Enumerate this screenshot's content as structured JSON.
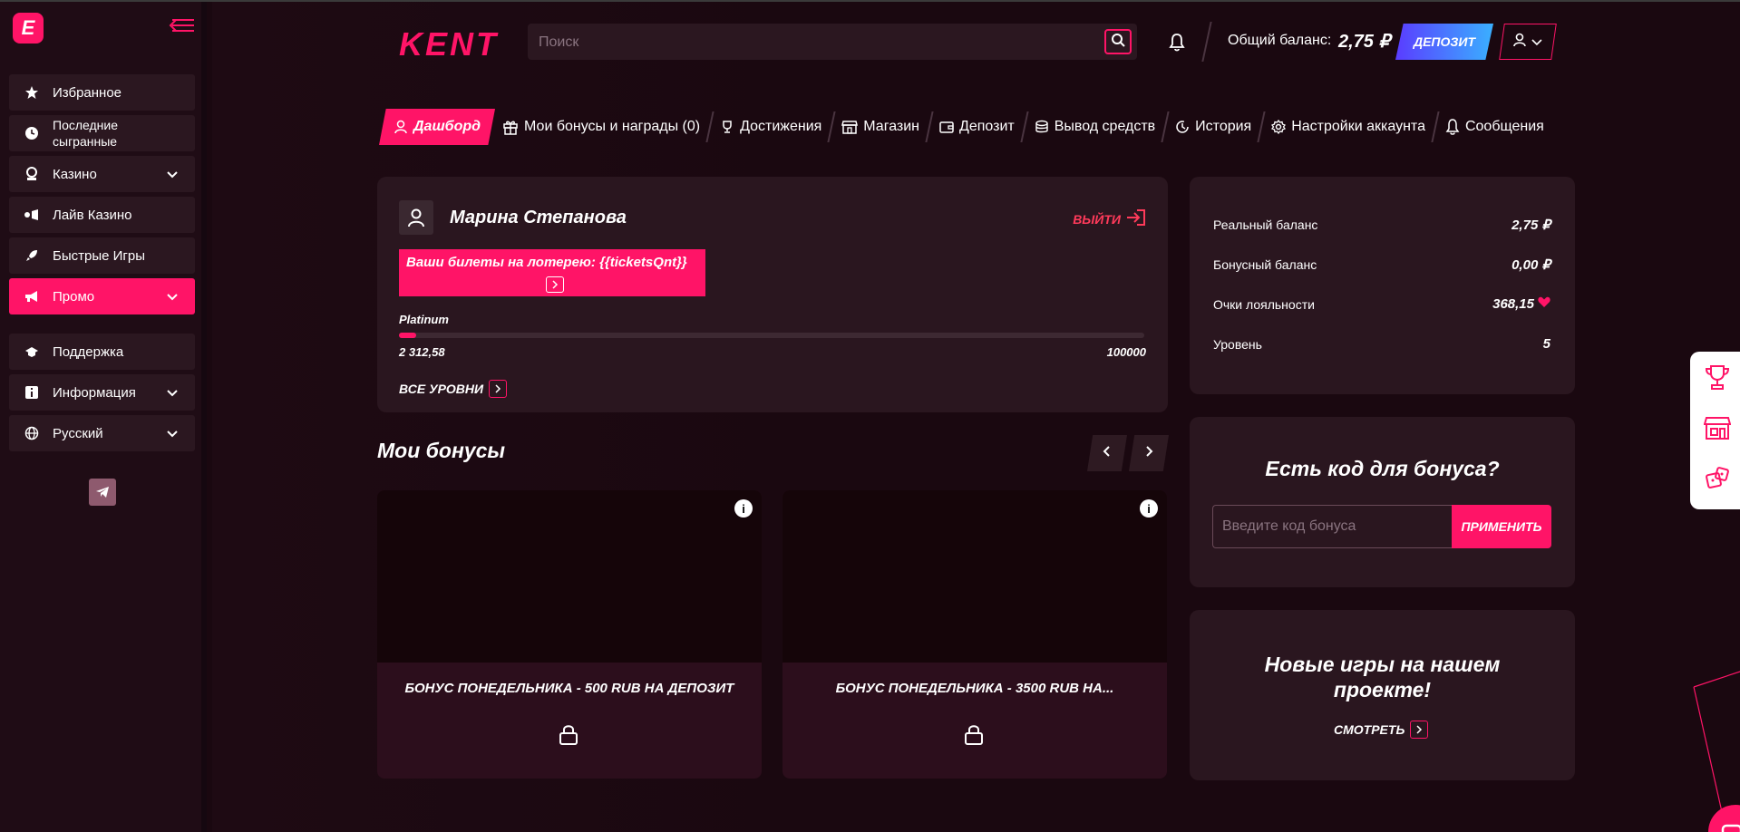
{
  "brand": {
    "name": "KENT",
    "mini_logo_letter": "E"
  },
  "sidebar": {
    "items": [
      {
        "label": "Избранное",
        "icon": "star-icon",
        "has_chevron": false,
        "active": false
      },
      {
        "label": "Последние сыгранные",
        "icon": "clock-icon",
        "has_chevron": false,
        "active": false
      },
      {
        "label": "Казино",
        "icon": "casino-icon",
        "has_chevron": true,
        "active": false
      },
      {
        "label": "Лайв Казино",
        "icon": "live-casino-icon",
        "has_chevron": false,
        "active": false
      },
      {
        "label": "Быстрые Игры",
        "icon": "rocket-icon",
        "has_chevron": false,
        "active": false
      },
      {
        "label": "Промо",
        "icon": "megaphone-icon",
        "has_chevron": true,
        "active": true
      }
    ],
    "secondary": [
      {
        "label": "Поддержка",
        "icon": "support-icon",
        "has_chevron": false
      },
      {
        "label": "Информация",
        "icon": "info-icon",
        "has_chevron": true
      },
      {
        "label": "Русский",
        "icon": "globe-icon",
        "has_chevron": true
      }
    ]
  },
  "header": {
    "search_placeholder": "Поиск",
    "balance_label": "Общий баланс:",
    "balance_value": "2,75 ₽",
    "deposit_label": "ДЕПОЗИТ"
  },
  "tabs": [
    {
      "label": "Дашборд",
      "icon": "user-icon",
      "active": true
    },
    {
      "label": "Мои бонусы и награды (0)",
      "icon": "gift-icon",
      "active": false
    },
    {
      "label": "Достижения",
      "icon": "trophy-icon",
      "active": false
    },
    {
      "label": "Магазин",
      "icon": "shop-icon",
      "active": false
    },
    {
      "label": "Депозит",
      "icon": "wallet-icon",
      "active": false
    },
    {
      "label": "Вывод средств",
      "icon": "coins-icon",
      "active": false
    },
    {
      "label": "История",
      "icon": "history-icon",
      "active": false
    },
    {
      "label": "Настройки аккаунта",
      "icon": "gear-icon",
      "active": false
    },
    {
      "label": "Сообщения",
      "icon": "bell-icon",
      "active": false
    }
  ],
  "profile": {
    "name": "Марина Степанова",
    "logout_label": "ВЫЙТИ",
    "lottery_text": "Ваши билеты на лотерею: {{ticketsQnt}}",
    "level_name": "Platinum",
    "level_current": "2 312,58",
    "level_max": "100000",
    "progress_fraction": 0.023,
    "all_levels_label": "ВСЕ УРОВНИ"
  },
  "bonuses": {
    "title": "Мои бонусы",
    "items": [
      {
        "name": "БОНУС ПОНЕДЕЛЬНИКА - 500 RUB НА ДЕПОЗИТ"
      },
      {
        "name": "БОНУС ПОНЕДЕЛЬНИКА - 3500 RUB НА..."
      }
    ]
  },
  "balances": [
    {
      "label": "Реальный баланс",
      "value": "2,75 ₽"
    },
    {
      "label": "Бонусный баланс",
      "value": "0,00 ₽"
    },
    {
      "label": "Очки лояльности",
      "value": "368,15"
    },
    {
      "label": "Уровень",
      "value": "5"
    }
  ],
  "promo_code": {
    "title": "Есть код для бонуса?",
    "placeholder": "Введите код бонуса",
    "apply_label": "ПРИМЕНИТЬ"
  },
  "new_games": {
    "title": "Новые игры на нашем проекте!",
    "link_label": "СМОТРЕТЬ"
  },
  "colors": {
    "accent": "#ff1467",
    "background": "#1a0810",
    "card": "#2a161f",
    "deposit_gradient": [
      "#5a3cff",
      "#3ab0ff"
    ]
  }
}
